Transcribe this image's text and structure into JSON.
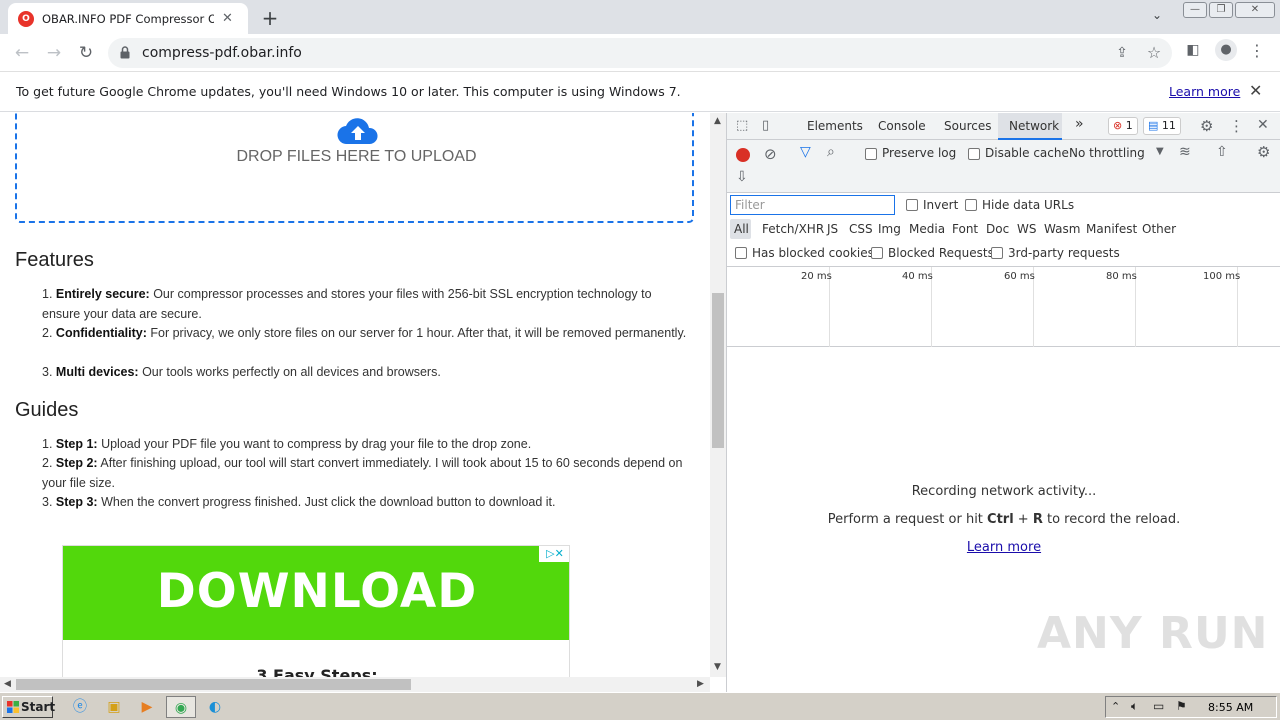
{
  "browser": {
    "tab_title": "OBAR.INFO PDF Compressor Online",
    "favicon_letter": "O",
    "url": "compress-pdf.obar.info"
  },
  "infobar": {
    "message": "To get future Google Chrome updates, you'll need Windows 10 or later. This computer is using Windows 7.",
    "learn_more": "Learn more"
  },
  "page": {
    "drop_text": "DROP FILES HERE TO UPLOAD",
    "features_heading": "Features",
    "features": [
      {
        "num": "1.",
        "title": "Entirely secure:",
        "text": " Our compressor processes and stores your files with 256-bit SSL encryption technology to ensure your data are secure."
      },
      {
        "num": "2.",
        "title": "Confidentiality:",
        "text": " For privacy, we only store files on our server for 1 hour. After that, it will be removed permanently."
      },
      {
        "num": "3.",
        "title": "Multi devices:",
        "text": " Our tools works perfectly on all devices and browsers."
      }
    ],
    "guides_heading": "Guides",
    "guides": [
      {
        "num": "1.",
        "title": "Step 1:",
        "text": " Upload your PDF file you want to compress by drag your file to the drop zone."
      },
      {
        "num": "2.",
        "title": "Step 2:",
        "text": " After finishing upload, our tool will start convert immediately. I will took about 15 to 60 seconds depend on your file size."
      },
      {
        "num": "3.",
        "title": "Step 3:",
        "text": " When the convert progress finished. Just click the download button to download it."
      }
    ],
    "ad": {
      "headline": "DOWNLOAD",
      "subline": "3 Easy Steps:",
      "choices": "▷✕",
      "color": "#52d80c"
    }
  },
  "devtools": {
    "tabs": [
      "Elements",
      "Console",
      "Sources",
      "Network"
    ],
    "active_tab": "Network",
    "more": "»",
    "errors_count": "1",
    "messages_count": "11",
    "preserve_log": "Preserve log",
    "disable_cache": "Disable cache",
    "throttling": "No throttling",
    "filter_placeholder": "Filter",
    "invert": "Invert",
    "hide_data_urls": "Hide data URLs",
    "types": [
      "All",
      "Fetch/XHR",
      "JS",
      "CSS",
      "Img",
      "Media",
      "Font",
      "Doc",
      "WS",
      "Wasm",
      "Manifest",
      "Other"
    ],
    "has_blocked_cookies": "Has blocked cookies",
    "blocked_requests": "Blocked Requests",
    "third_party": "3rd-party requests",
    "timeline_labels": [
      "20 ms",
      "40 ms",
      "60 ms",
      "80 ms",
      "100 ms"
    ],
    "empty_title": "Recording network activity...",
    "empty_hint_pre": "Perform a request or hit ",
    "empty_hint_keys": "Ctrl",
    "empty_hint_plus": " + ",
    "empty_hint_key2": "R",
    "empty_hint_post": " to record the reload.",
    "learn_more": "Learn more",
    "watermark": "ANY RUN"
  },
  "taskbar": {
    "start": "Start",
    "time": "8:55 AM"
  }
}
